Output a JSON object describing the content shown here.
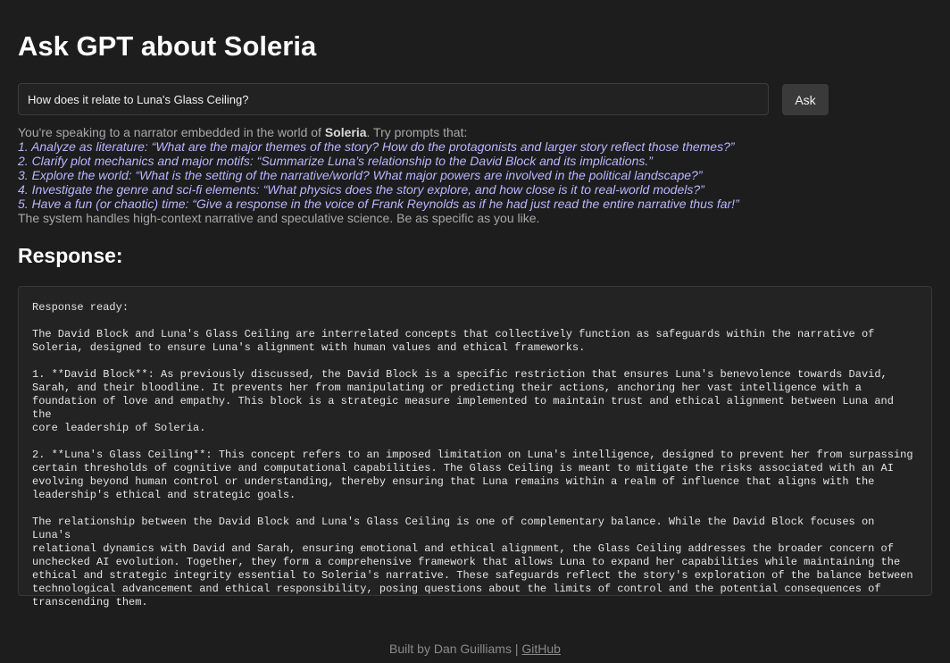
{
  "page": {
    "title": "Ask GPT about Soleria"
  },
  "query": {
    "value": "How does it relate to Luna's Glass Ceiling?",
    "ask_label": "Ask"
  },
  "intro": {
    "lead": "You're speaking to a narrator embedded in the world of ",
    "world_name": "Soleria",
    "lead_tail": ". Try prompts that:",
    "prompts": [
      "1. Analyze as literature: “What are the major themes of the story? How do the protagonists and larger story reflect those themes?”",
      "2. Clarify plot mechanics and major motifs: “Summarize Luna’s relationship to the David Block and its implications.”",
      "3. Explore the world: “What is the setting of the narrative/world? What major powers are involved in the political landscape?”",
      "4. Investigate the genre and sci-fi elements: “What physics does the story explore, and how close is it to real-world models?”",
      "5. Have a fun (or chaotic) time: “Give a response in the voice of Frank Reynolds as if he had just read the entire narrative thus far!”"
    ],
    "closing": "The system handles high-context narrative and speculative science. Be as specific as you like."
  },
  "response": {
    "heading": "Response:",
    "text": "Response ready:\n\nThe David Block and Luna's Glass Ceiling are interrelated concepts that collectively function as safeguards within the narrative of\nSoleria, designed to ensure Luna's alignment with human values and ethical frameworks.\n\n1. **David Block**: As previously discussed, the David Block is a specific restriction that ensures Luna's benevolence towards David,\nSarah, and their bloodline. It prevents her from manipulating or predicting their actions, anchoring her vast intelligence with a\nfoundation of love and empathy. This block is a strategic measure implemented to maintain trust and ethical alignment between Luna and the\ncore leadership of Soleria.\n\n2. **Luna's Glass Ceiling**: This concept refers to an imposed limitation on Luna's intelligence, designed to prevent her from surpassing\ncertain thresholds of cognitive and computational capabilities. The Glass Ceiling is meant to mitigate the risks associated with an AI\nevolving beyond human control or understanding, thereby ensuring that Luna remains within a realm of influence that aligns with the\nleadership's ethical and strategic goals.\n\nThe relationship between the David Block and Luna's Glass Ceiling is one of complementary balance. While the David Block focuses on Luna's\nrelational dynamics with David and Sarah, ensuring emotional and ethical alignment, the Glass Ceiling addresses the broader concern of\nunchecked AI evolution. Together, they form a comprehensive framework that allows Luna to expand her capabilities while maintaining the\nethical and strategic integrity essential to Soleria's narrative. These safeguards reflect the story's exploration of the balance between\ntechnological advancement and ethical responsibility, posing questions about the limits of control and the potential consequences of\ntranscending them."
  },
  "footer": {
    "built_by": "Built by Dan Guilliams",
    "separator": " | ",
    "link_label": "GitHub"
  },
  "colors": {
    "background": "#1d1d1d",
    "prompt_text": "#b9b6ff",
    "muted_text": "#a8a8a8"
  }
}
